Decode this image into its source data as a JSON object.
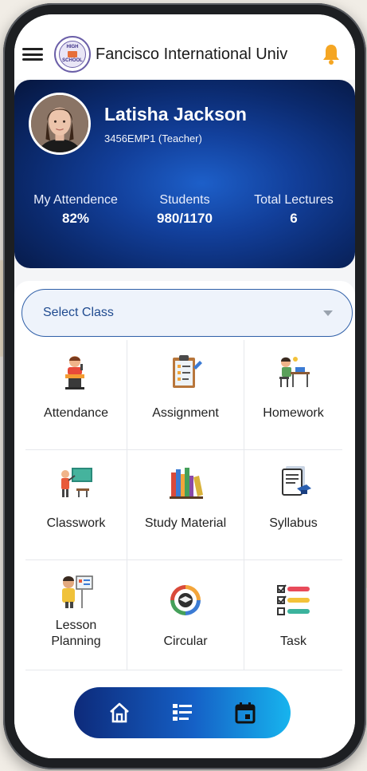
{
  "app": {
    "title": "Fancisco International Univ",
    "logo_text_top": "HIGH",
    "logo_text_bottom": "SCHOOL"
  },
  "profile": {
    "name": "Latisha Jackson",
    "employee": "3456EMP1 (Teacher)",
    "stats": [
      {
        "label": "My Attendence",
        "value": "82%"
      },
      {
        "label": "Students",
        "value": "980/1170"
      },
      {
        "label": "Total Lectures",
        "value": "6"
      }
    ]
  },
  "select_class": {
    "placeholder": "Select Class"
  },
  "menu": [
    {
      "label": "Attendance",
      "icon": "teacher-podium-icon"
    },
    {
      "label": "Assignment",
      "icon": "clipboard-pen-icon"
    },
    {
      "label": "Homework",
      "icon": "student-desk-icon"
    },
    {
      "label": "Classwork",
      "icon": "teacher-board-icon"
    },
    {
      "label": "Study Material",
      "icon": "books-icon"
    },
    {
      "label": "Syllabus",
      "icon": "document-cap-icon"
    },
    {
      "label": "Lesson Planning",
      "icon": "teacher-planning-icon"
    },
    {
      "label": "Circular",
      "icon": "circular-cycle-icon"
    },
    {
      "label": "Task",
      "icon": "checklist-icon"
    }
  ],
  "bottom_nav": [
    "home-icon",
    "list-icon",
    "calendar-icon"
  ],
  "colors": {
    "primary": "#123f9a",
    "accent": "#17b4ee",
    "bell": "#f5a623"
  }
}
